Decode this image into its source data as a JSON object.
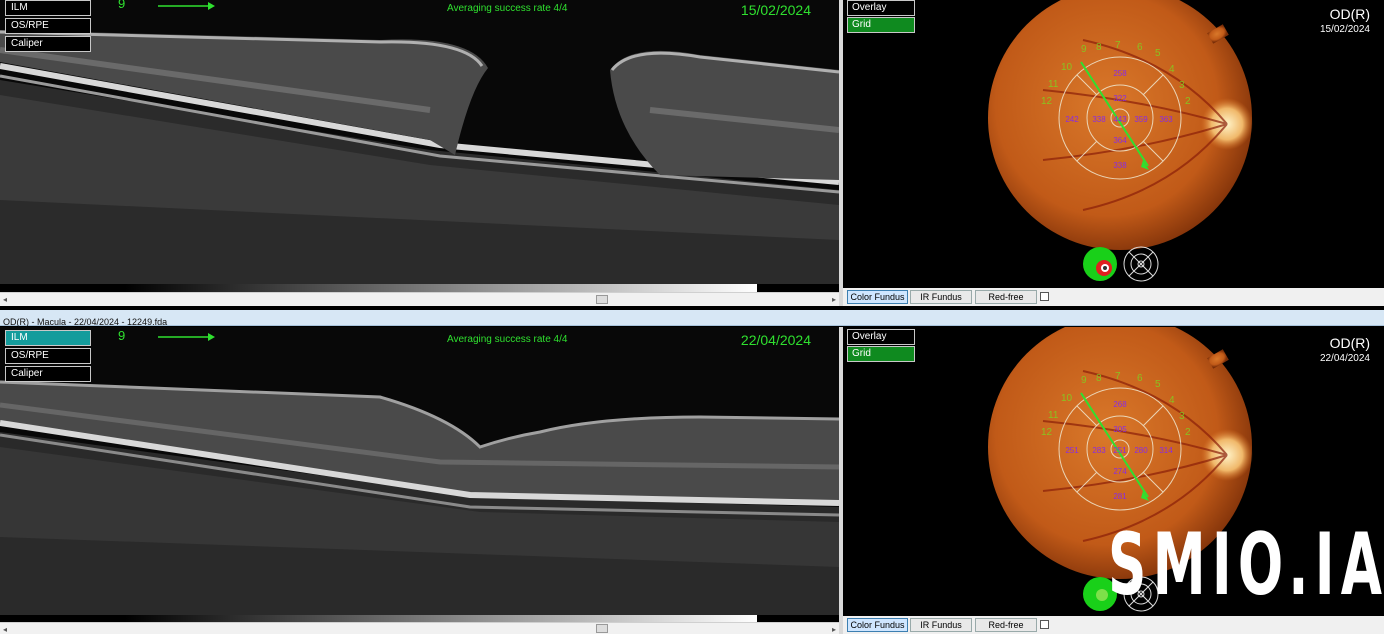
{
  "top": {
    "layer_buttons": [
      "ILM",
      "OS/RPE",
      "Caliper"
    ],
    "active_layer": "",
    "slice_number": "9",
    "averaging": "Averaging success rate  4/4",
    "date": "15/02/2024",
    "overlay_label": "Overlay",
    "grid_label": "Grid",
    "eye": "OD(R)",
    "eye_date": "15/02/2024",
    "grid_values": {
      "superior_outer": "258",
      "superior_inner": "322",
      "temporal_outer": "242",
      "temporal_inner": "338",
      "center": "443",
      "nasal_inner": "359",
      "nasal_outer": "363",
      "inferior_inner": "364",
      "inferior_outer": "338"
    },
    "tabs": [
      "Color Fundus",
      "IR Fundus",
      "Red-free"
    ]
  },
  "titlebar": "OD(R) - Macula - 22/04/2024 - 12249.fda",
  "bottom": {
    "layer_buttons": [
      "ILM",
      "OS/RPE",
      "Caliper"
    ],
    "active_layer": "ILM",
    "slice_number": "9",
    "averaging": "Averaging success rate  4/4",
    "date": "22/04/2024",
    "overlay_label": "Overlay",
    "grid_label": "Grid",
    "eye": "OD(R)",
    "eye_date": "22/04/2024",
    "grid_values": {
      "superior_outer": "268",
      "superior_inner": "305",
      "temporal_outer": "251",
      "temporal_inner": "283",
      "center": "251",
      "nasal_inner": "280",
      "nasal_outer": "314",
      "inferior_inner": "274",
      "inferior_outer": "281"
    },
    "tabs": [
      "Color Fundus",
      "IR Fundus",
      "Red-free"
    ]
  },
  "clock_numbers": [
    "9",
    "8",
    "7",
    "6",
    "5",
    "10",
    "4",
    "11",
    "3",
    "12",
    "2"
  ],
  "watermark": "SMIO.IA",
  "colors": {
    "accent_green": "#2fe02f",
    "grid_green": "#0f8a1f",
    "active_teal": "#149c9c",
    "grid_value_purple": "#8a2be2"
  }
}
